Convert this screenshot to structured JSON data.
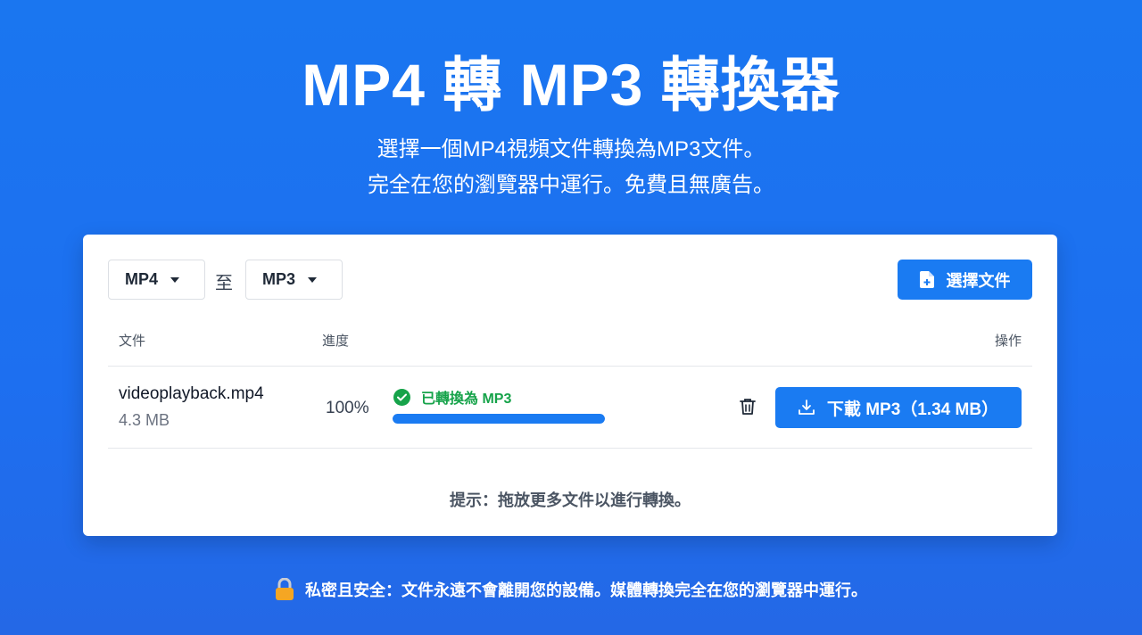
{
  "hero": {
    "title": "MP4 轉 MP3 轉換器",
    "subtitle_line1": "選擇一個MP4視頻文件轉換為MP3文件。",
    "subtitle_line2": "完全在您的瀏覽器中運行。免費且無廣告。"
  },
  "converter": {
    "from_format": "MP4",
    "to_label": "至",
    "to_format": "MP3",
    "choose_button": "選擇文件"
  },
  "table": {
    "headers": {
      "file": "文件",
      "progress": "進度",
      "actions": "操作"
    },
    "rows": [
      {
        "file_name": "videoplayback.mp4",
        "file_size": "4.3 MB",
        "percent": "100%",
        "progress_fraction": 1.0,
        "status": "已轉換為 MP3",
        "download_label": "下載 MP3（1.34 MB）"
      }
    ]
  },
  "hint": "提示：拖放更多文件以進行轉換。",
  "footer": {
    "text": "私密且安全：文件永遠不會離開您的設備。媒體轉換完全在您的瀏覽器中運行。"
  },
  "colors": {
    "background": "#1a76f0",
    "accent": "#1a7bf2",
    "success": "#16a34a",
    "lock": "#f5a623"
  },
  "icons": {
    "choose": "file-plus-icon",
    "status": "check-circle-icon",
    "delete": "trash-icon",
    "download": "download-icon",
    "footer": "lock-icon"
  }
}
